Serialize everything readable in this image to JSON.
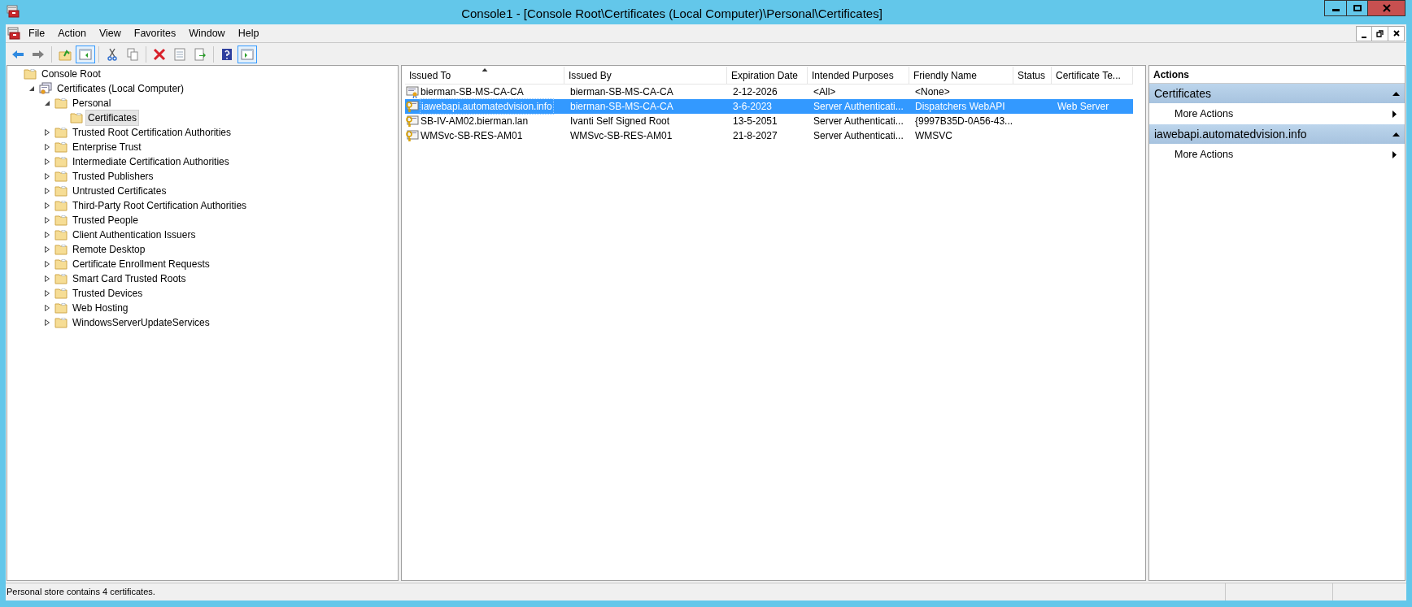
{
  "window": {
    "title": "Console1 - [Console Root\\Certificates (Local Computer)\\Personal\\Certificates]"
  },
  "menu": [
    "File",
    "Action",
    "View",
    "Favorites",
    "Window",
    "Help"
  ],
  "tree": [
    {
      "label": "Console Root",
      "kind": "folder",
      "selected": false,
      "children": [
        {
          "label": "Certificates (Local Computer)",
          "kind": "store",
          "expanded": true,
          "selected": false,
          "children": [
            {
              "label": "Personal",
              "kind": "folder",
              "expanded": true,
              "selected": false,
              "children": [
                {
                  "label": "Certificates",
                  "kind": "folder",
                  "selected": true
                }
              ]
            },
            {
              "label": "Trusted Root Certification Authorities",
              "kind": "folder",
              "expanded": false,
              "selected": false
            },
            {
              "label": "Enterprise Trust",
              "kind": "folder",
              "expanded": false,
              "selected": false
            },
            {
              "label": "Intermediate Certification Authorities",
              "kind": "folder",
              "expanded": false,
              "selected": false
            },
            {
              "label": "Trusted Publishers",
              "kind": "folder",
              "expanded": false,
              "selected": false
            },
            {
              "label": "Untrusted Certificates",
              "kind": "folder",
              "expanded": false,
              "selected": false
            },
            {
              "label": "Third-Party Root Certification Authorities",
              "kind": "folder",
              "expanded": false,
              "selected": false
            },
            {
              "label": "Trusted People",
              "kind": "folder",
              "expanded": false,
              "selected": false
            },
            {
              "label": "Client Authentication Issuers",
              "kind": "folder",
              "expanded": false,
              "selected": false
            },
            {
              "label": "Remote Desktop",
              "kind": "folder",
              "expanded": false,
              "selected": false
            },
            {
              "label": "Certificate Enrollment Requests",
              "kind": "folder",
              "expanded": false,
              "selected": false
            },
            {
              "label": "Smart Card Trusted Roots",
              "kind": "folder",
              "expanded": false,
              "selected": false
            },
            {
              "label": "Trusted Devices",
              "kind": "folder",
              "expanded": false,
              "selected": false
            },
            {
              "label": "Web Hosting",
              "kind": "folder",
              "expanded": false,
              "selected": false
            },
            {
              "label": "WindowsServerUpdateServices",
              "kind": "folder",
              "expanded": false,
              "selected": false
            }
          ]
        }
      ]
    }
  ],
  "table": {
    "columns": [
      {
        "label": "Issued To",
        "sorted": true
      },
      {
        "label": "Issued By",
        "sorted": false
      },
      {
        "label": "Expiration Date",
        "sorted": false
      },
      {
        "label": "Intended Purposes",
        "sorted": false
      },
      {
        "label": "Friendly Name",
        "sorted": false
      },
      {
        "label": "Status",
        "sorted": false
      },
      {
        "label": "Certificate Te...",
        "sorted": false
      }
    ],
    "rows": [
      {
        "kind": "plain",
        "selected": false,
        "cells": [
          "bierman-SB-MS-CA-CA",
          "bierman-SB-MS-CA-CA",
          "2-12-2026",
          "<All>",
          "<None>",
          "",
          ""
        ]
      },
      {
        "kind": "keyed",
        "selected": true,
        "cells": [
          "iawebapi.automatedvision.info",
          "bierman-SB-MS-CA-CA",
          "3-6-2023",
          "Server Authenticati...",
          "Dispatchers WebAPI",
          "",
          "Web Server"
        ]
      },
      {
        "kind": "keyed",
        "selected": false,
        "cells": [
          "SB-IV-AM02.bierman.lan",
          "Ivanti Self Signed Root",
          "13-5-2051",
          "Server Authenticati...",
          "{9997B35D-0A56-43...",
          "",
          ""
        ]
      },
      {
        "kind": "keyed",
        "selected": false,
        "cells": [
          "WMSvc-SB-RES-AM01",
          "WMSvc-SB-RES-AM01",
          "21-8-2027",
          "Server Authenticati...",
          "WMSVC",
          "",
          ""
        ]
      }
    ]
  },
  "actions": {
    "title": "Actions",
    "sections": [
      {
        "title": "Certificates",
        "expanded": true,
        "items": [
          "More Actions"
        ]
      },
      {
        "title": "iawebapi.automatedvision.info",
        "expanded": true,
        "items": [
          "More Actions"
        ]
      }
    ]
  },
  "status_bar": {
    "text": "Personal store contains 4 certificates."
  }
}
